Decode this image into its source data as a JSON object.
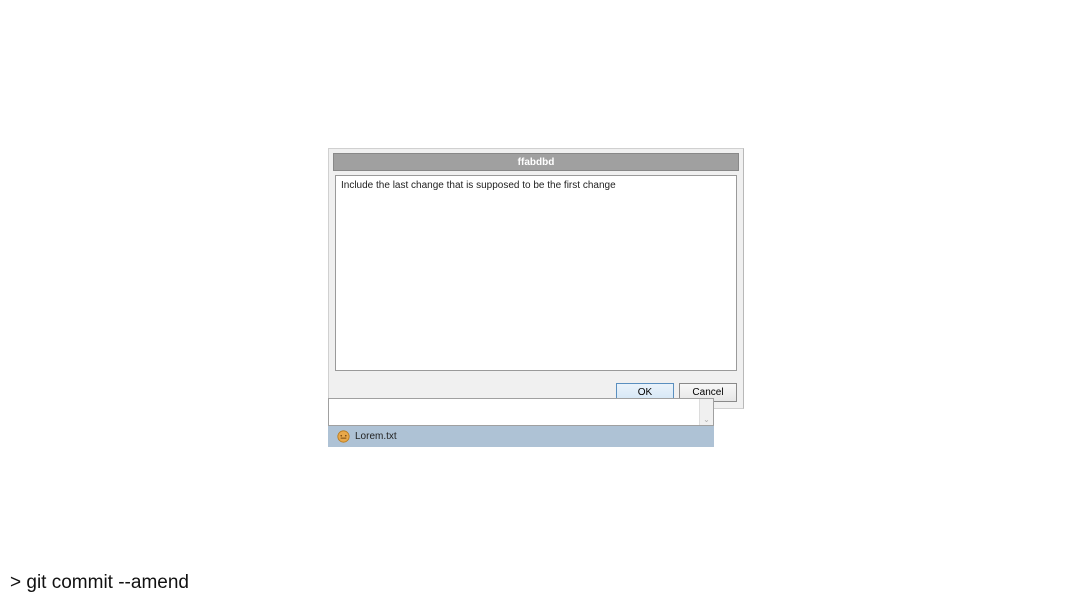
{
  "dialog": {
    "title": "ffabdbd",
    "message": "Include the last change that is supposed to be the first change",
    "ok_label": "OK",
    "cancel_label": "Cancel"
  },
  "file_panel": {
    "filename": "Lorem.txt"
  },
  "terminal": {
    "command": "> git commit --amend"
  }
}
